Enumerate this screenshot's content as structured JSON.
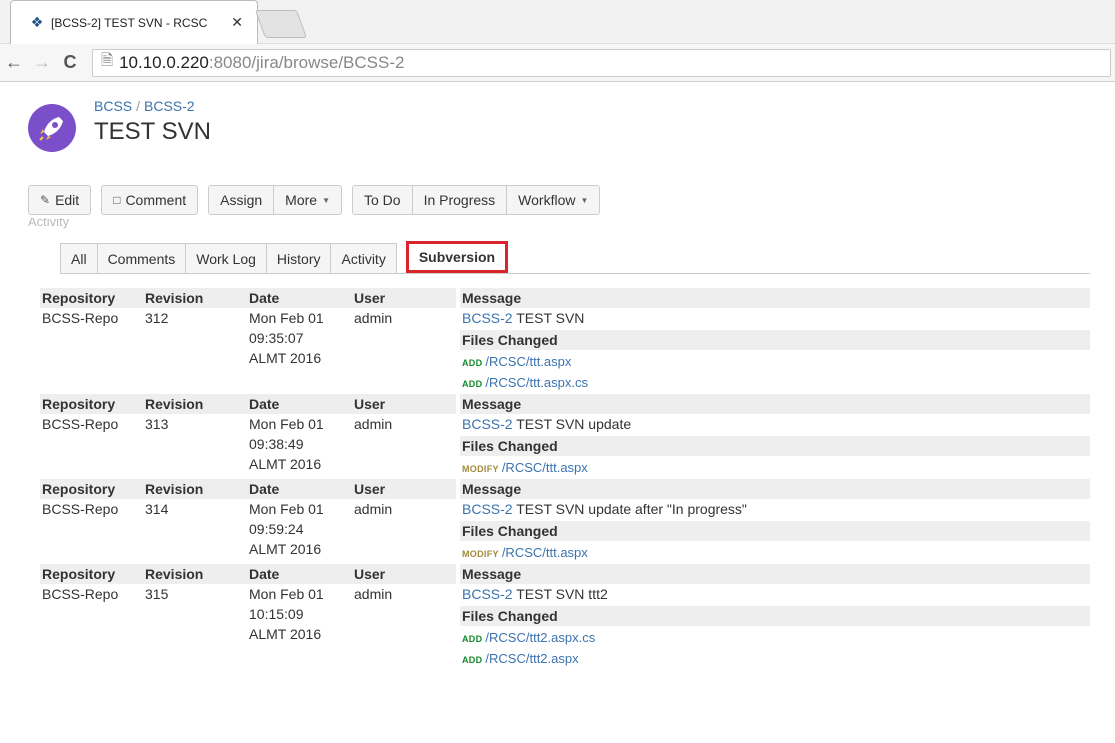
{
  "browser": {
    "tab_title": "[BCSS-2] TEST SVN - RCSC",
    "url_host": "10.10.0.220",
    "url_rest": ":8080/jira/browse/BCSS-2"
  },
  "issue": {
    "project": "BCSS",
    "key": "BCSS-2",
    "title": "TEST SVN"
  },
  "opsbar": {
    "edit": "Edit",
    "comment": "Comment",
    "assign": "Assign",
    "more": "More",
    "todo": "To Do",
    "in_progress": "In Progress",
    "workflow": "Workflow"
  },
  "cut_text": "Activity",
  "tabs": {
    "all": "All",
    "comments": "Comments",
    "worklog": "Work Log",
    "history": "History",
    "activity": "Activity",
    "subversion": "Subversion"
  },
  "headers": {
    "repository": "Repository",
    "revision": "Revision",
    "date": "Date",
    "user": "User",
    "message": "Message",
    "files_changed": "Files Changed"
  },
  "commits": [
    {
      "repo": "BCSS-Repo",
      "revision": "312",
      "date": [
        "Mon Feb 01",
        "09:35:07",
        "ALMT 2016"
      ],
      "user": "admin",
      "msg_key": "BCSS-2",
      "msg_text": " TEST SVN",
      "files": [
        {
          "action": "ADD",
          "path": "/RCSC/ttt.aspx"
        },
        {
          "action": "ADD",
          "path": "/RCSC/ttt.aspx.cs"
        }
      ]
    },
    {
      "repo": "BCSS-Repo",
      "revision": "313",
      "date": [
        "Mon Feb 01",
        "09:38:49",
        "ALMT 2016"
      ],
      "user": "admin",
      "msg_key": "BCSS-2",
      "msg_text": " TEST SVN update",
      "files": [
        {
          "action": "MODIFY",
          "path": "/RCSC/ttt.aspx"
        }
      ]
    },
    {
      "repo": "BCSS-Repo",
      "revision": "314",
      "date": [
        "Mon Feb 01",
        "09:59:24",
        "ALMT 2016"
      ],
      "user": "admin",
      "msg_key": "BCSS-2",
      "msg_text": " TEST SVN update after \"In progress\"",
      "files": [
        {
          "action": "MODIFY",
          "path": "/RCSC/ttt.aspx"
        }
      ]
    },
    {
      "repo": "BCSS-Repo",
      "revision": "315",
      "date": [
        "Mon Feb 01",
        "10:15:09",
        "ALMT 2016"
      ],
      "user": "admin",
      "msg_key": "BCSS-2",
      "msg_text": " TEST SVN ttt2",
      "files": [
        {
          "action": "ADD",
          "path": "/RCSC/ttt2.aspx.cs"
        },
        {
          "action": "ADD",
          "path": "/RCSC/ttt2.aspx"
        }
      ]
    }
  ],
  "icons": {
    "favicon": "jira-icon",
    "close": "close-icon",
    "back": "back-arrow-icon",
    "forward": "forward-arrow-icon",
    "reload": "reload-icon",
    "page": "page-icon",
    "edit": "pencil-icon",
    "comment": "speech-bubble-icon",
    "project_avatar": "rocket-icon"
  },
  "colors": {
    "link": "#3b73af",
    "add": "#14892c",
    "modify": "#a08b3c",
    "highlight": "#d9232d"
  }
}
